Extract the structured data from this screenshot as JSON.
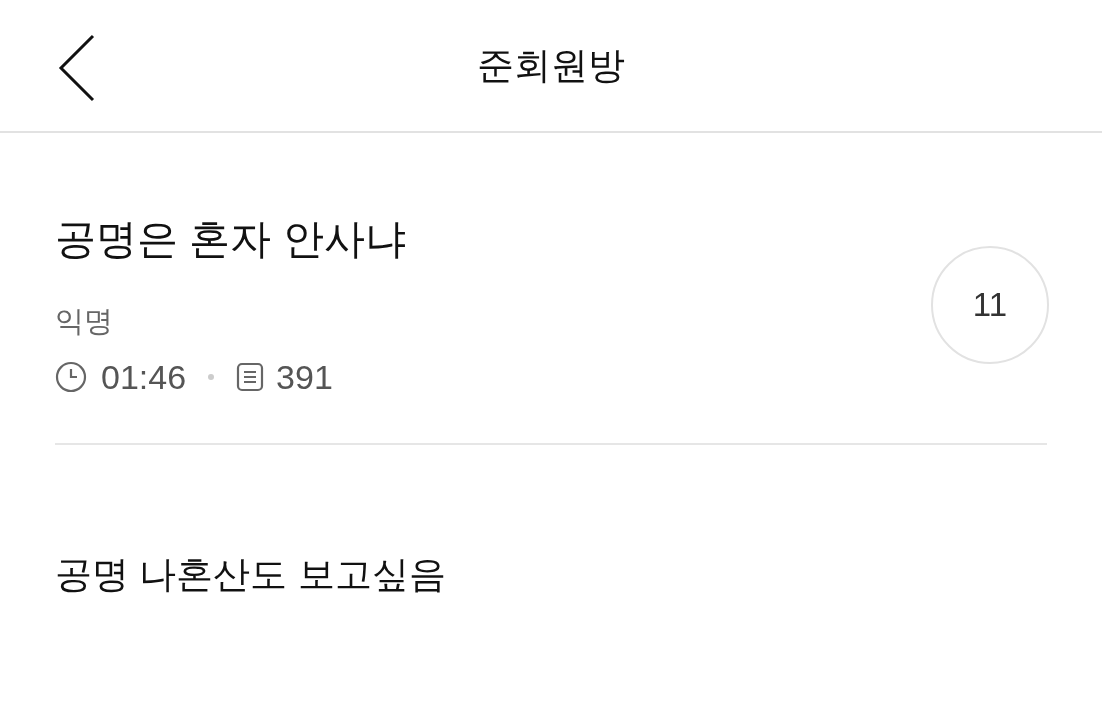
{
  "header": {
    "title": "준회원방"
  },
  "post": {
    "title": "공명은 혼자 안사냐",
    "author": "익명",
    "time": "01:46",
    "views": "391",
    "comment_count": "11",
    "body": "공명 나혼산도 보고싶음"
  }
}
